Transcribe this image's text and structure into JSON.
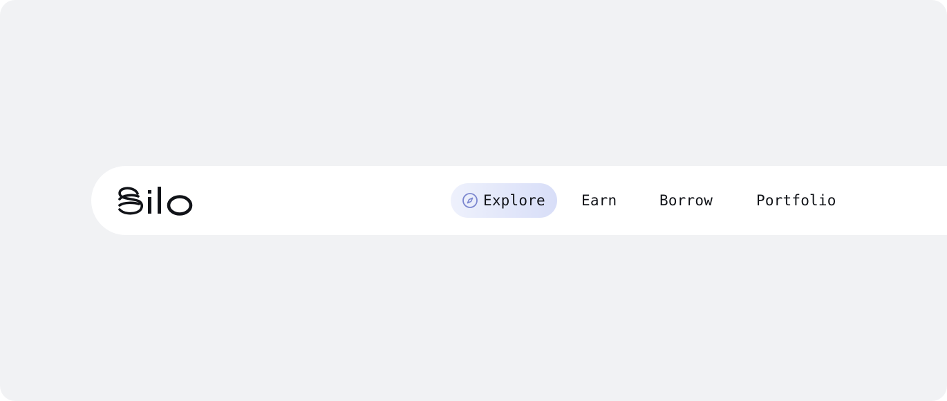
{
  "brand": {
    "name": "Silo",
    "logo_icon": "silo-logo"
  },
  "nav": {
    "items": [
      {
        "label": "Explore",
        "icon": "compass-icon",
        "active": true
      },
      {
        "label": "Earn",
        "active": false
      },
      {
        "label": "Borrow",
        "active": false
      },
      {
        "label": "Portfolio",
        "active": false
      }
    ]
  },
  "colors": {
    "page_background": "#f1f2f4",
    "navbar_background": "#ffffff",
    "text": "#111318",
    "active_pill_start": "#eef1fc",
    "active_pill_end": "#d8def8",
    "active_icon": "#7b86cf"
  }
}
